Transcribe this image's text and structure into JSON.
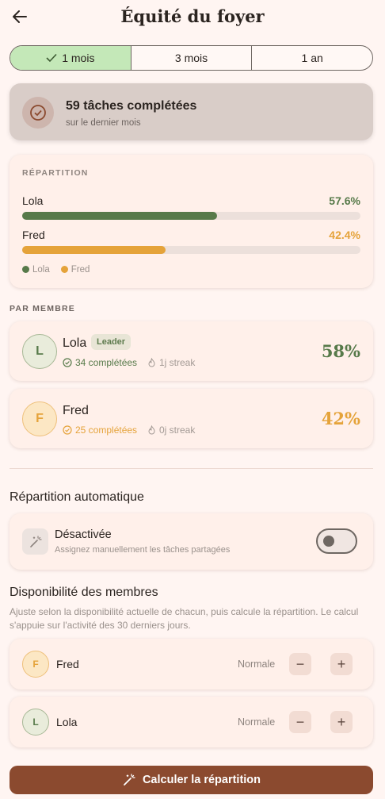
{
  "header": {
    "title": "Équité du foyer",
    "back_icon": "arrow-left-icon"
  },
  "period_tabs": [
    {
      "label": "1 mois",
      "selected": true
    },
    {
      "label": "3 mois",
      "selected": false
    },
    {
      "label": "1 an",
      "selected": false
    }
  ],
  "summary": {
    "title": "59 tâches complétées",
    "subtitle": "sur le dernier mois",
    "icon": "check-circle-icon"
  },
  "repartition": {
    "heading": "RÉPARTITION",
    "rows": [
      {
        "name": "Lola",
        "percent_label": "57.6%",
        "percent": 57.6,
        "color": "#577a4a"
      },
      {
        "name": "Fred",
        "percent_label": "42.4%",
        "percent": 42.4,
        "color": "#e5a33a"
      }
    ],
    "legend": [
      {
        "label": "Lola",
        "color": "#577a4a"
      },
      {
        "label": "Fred",
        "color": "#e5a33a"
      }
    ]
  },
  "members_heading": "PAR MEMBRE",
  "members": [
    {
      "initial": "L",
      "name": "Lola",
      "badge": "Leader",
      "completed": "34 complétées",
      "streak": "1j streak",
      "percent": "58%",
      "color": "#577a4a",
      "avatar_bg": "#e9ecdb",
      "avatar_border": "#a7b896"
    },
    {
      "initial": "F",
      "name": "Fred",
      "badge": "",
      "completed": "25 complétées",
      "streak": "0j streak",
      "percent": "42%",
      "color": "#e5a33a",
      "avatar_bg": "#fce7c4",
      "avatar_border": "#eec07a"
    }
  ],
  "auto": {
    "heading": "Répartition automatique",
    "status": "Désactivée",
    "subtitle": "Assignez manuellement les tâches partagées",
    "enabled": false
  },
  "availability": {
    "heading": "Disponibilité des membres",
    "description": "Ajuste selon la disponibilité actuelle de chacun, puis calcule la répartition. Le calcul s'appuie sur l'activité des 30 derniers jours.",
    "members": [
      {
        "initial": "F",
        "name": "Fred",
        "level": "Normale",
        "color": "#e5a33a",
        "avatar_bg": "#fce7c4",
        "avatar_border": "#eec07a"
      },
      {
        "initial": "L",
        "name": "Lola",
        "level": "Normale",
        "color": "#577a4a",
        "avatar_bg": "#e9ecdb",
        "avatar_border": "#a7b896"
      }
    ],
    "minus": "−",
    "plus": "+"
  },
  "cta": {
    "label": "Calculer la répartition",
    "icon": "magic-wand-icon"
  }
}
